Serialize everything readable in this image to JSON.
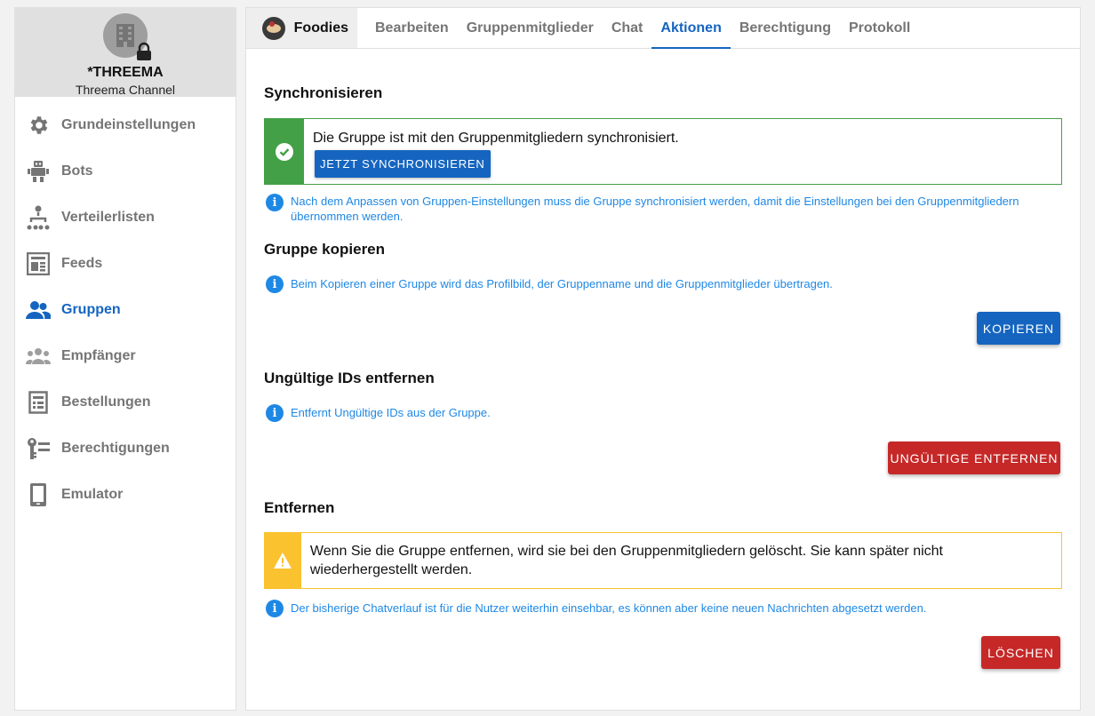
{
  "sidebar": {
    "account_name": "*THREEMA",
    "account_type": "Threema Channel",
    "items": [
      {
        "label": "Grundeinstellungen",
        "icon": "gear-icon"
      },
      {
        "label": "Bots",
        "icon": "robot-icon"
      },
      {
        "label": "Verteilerlisten",
        "icon": "distribution-icon"
      },
      {
        "label": "Feeds",
        "icon": "feed-icon"
      },
      {
        "label": "Gruppen",
        "icon": "groups-icon",
        "active": true
      },
      {
        "label": "Empfänger",
        "icon": "recipients-icon"
      },
      {
        "label": "Bestellungen",
        "icon": "orders-icon"
      },
      {
        "label": "Berechtigungen",
        "icon": "permissions-icon"
      },
      {
        "label": "Emulator",
        "icon": "phone-icon"
      }
    ]
  },
  "tabs": {
    "group_name": "Foodies",
    "items": [
      "Bearbeiten",
      "Gruppenmitglieder",
      "Chat",
      "Aktionen",
      "Berechtigung",
      "Protokoll"
    ],
    "active": "Aktionen"
  },
  "sync": {
    "title": "Synchronisieren",
    "status": "Die Gruppe ist mit den Gruppenmitgliedern synchronisiert.",
    "button": "JETZT SYNCHRONISIEREN",
    "info": "Nach dem Anpassen von Gruppen-Einstellungen muss die Gruppe synchronisiert werden, damit die Einstellungen bei den Gruppenmitgliedern übernommen werden."
  },
  "copy": {
    "title": "Gruppe kopieren",
    "info": "Beim Kopieren einer Gruppe wird das Profilbild, der Gruppenname und die Gruppenmitglieder übertragen.",
    "button": "KOPIEREN"
  },
  "invalid": {
    "title": "Ungültige IDs entfernen",
    "info": "Entfernt Ungültige IDs aus der Gruppe.",
    "button": "UNGÜLTIGE ENTFERNEN"
  },
  "remove": {
    "title": "Entfernen",
    "warning": "Wenn Sie die Gruppe entfernen, wird sie bei den Gruppenmitgliedern gelöscht. Sie kann später nicht wiederhergestellt werden.",
    "info": "Der bisherige Chatverlauf ist für die Nutzer weiterhin einsehbar, es können aber keine neuen Nachrichten abgesetzt werden.",
    "button": "LÖSCHEN"
  },
  "colors": {
    "accent": "#1565c0",
    "success": "#43a047",
    "warning": "#f9c22e",
    "danger": "#c62828",
    "info": "#1e88e5"
  }
}
